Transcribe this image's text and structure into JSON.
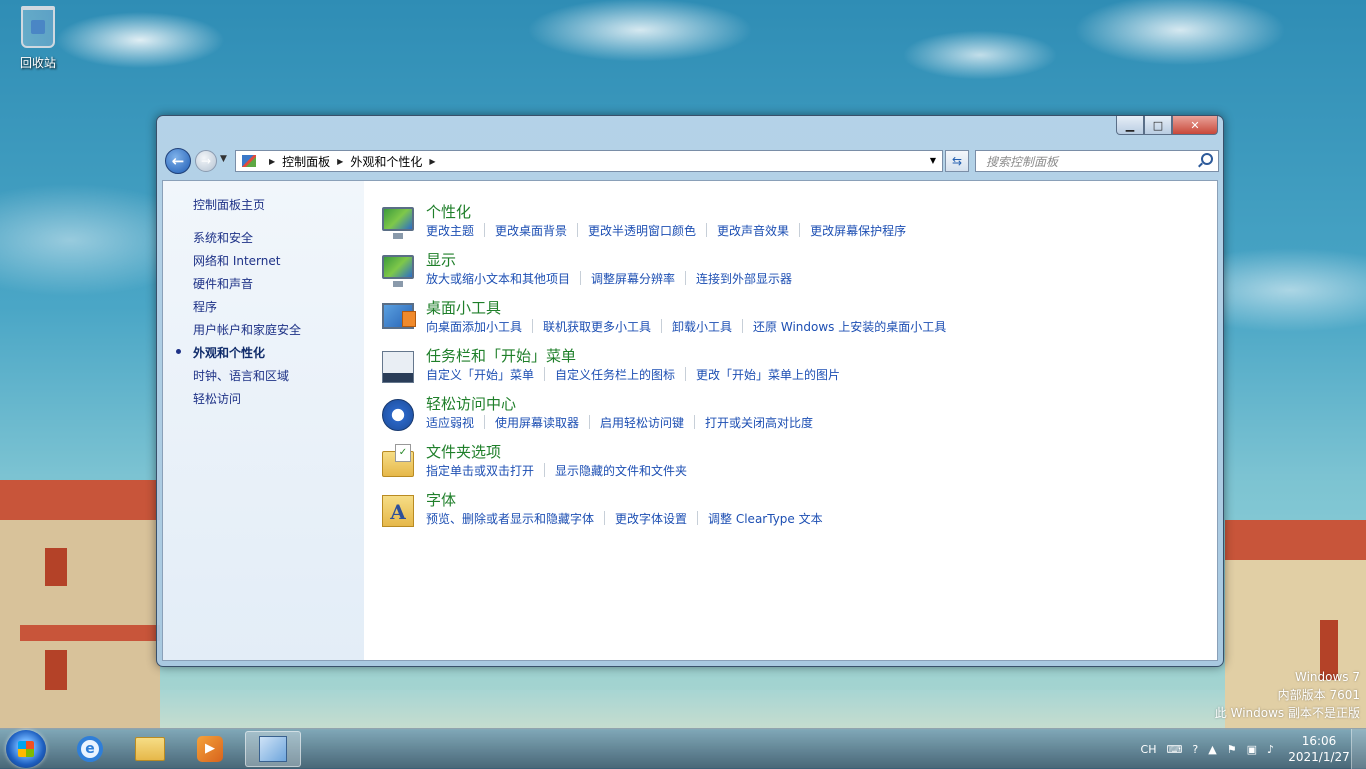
{
  "desktop": {
    "recycle_bin_label": "回收站",
    "watermark": {
      "line1": "Windows 7",
      "line2": "内部版本 7601",
      "line3": "此 Windows 副本不是正版"
    }
  },
  "window": {
    "caption_buttons": {
      "minimize": "▁",
      "maximize": "□",
      "close": "✕"
    },
    "breadcrumb": [
      "控制面板",
      "外观和个性化"
    ],
    "search_placeholder": "搜索控制面板"
  },
  "left_pane": {
    "home": "控制面板主页",
    "items": [
      "系统和安全",
      "网络和 Internet",
      "硬件和声音",
      "程序",
      "用户帐户和家庭安全",
      "外观和个性化",
      "时钟、语言和区域",
      "轻松访问"
    ],
    "current_index": 5
  },
  "categories": [
    {
      "title": "个性化",
      "icon": "personalization-icon",
      "links": [
        "更改主题",
        "更改桌面背景",
        "更改半透明窗口颜色",
        "更改声音效果",
        "更改屏幕保护程序"
      ]
    },
    {
      "title": "显示",
      "icon": "display-icon",
      "links": [
        "放大或缩小文本和其他项目",
        "调整屏幕分辨率",
        "连接到外部显示器"
      ]
    },
    {
      "title": "桌面小工具",
      "icon": "gadgets-icon",
      "links": [
        "向桌面添加小工具",
        "联机获取更多小工具",
        "卸载小工具",
        "还原 Windows 上安装的桌面小工具"
      ]
    },
    {
      "title": "任务栏和「开始」菜单",
      "icon": "taskbar-icon",
      "links": [
        "自定义「开始」菜单",
        "自定义任务栏上的图标",
        "更改「开始」菜单上的图片"
      ]
    },
    {
      "title": "轻松访问中心",
      "icon": "ease-of-access-icon",
      "links": [
        "适应弱视",
        "使用屏幕读取器",
        "启用轻松访问键",
        "打开或关闭高对比度"
      ]
    },
    {
      "title": "文件夹选项",
      "icon": "folder-options-icon",
      "links": [
        "指定单击或双击打开",
        "显示隐藏的文件和文件夹"
      ]
    },
    {
      "title": "字体",
      "icon": "fonts-icon",
      "links": [
        "预览、删除或者显示和隐藏字体",
        "更改字体设置",
        "调整 ClearType 文本"
      ]
    }
  ],
  "taskbar": {
    "apps": [
      "internet-explorer-icon",
      "windows-explorer-icon",
      "media-player-icon",
      "control-panel-icon"
    ],
    "tray": {
      "lang": "CH",
      "time": "16:06",
      "date": "2021/1/27"
    }
  }
}
